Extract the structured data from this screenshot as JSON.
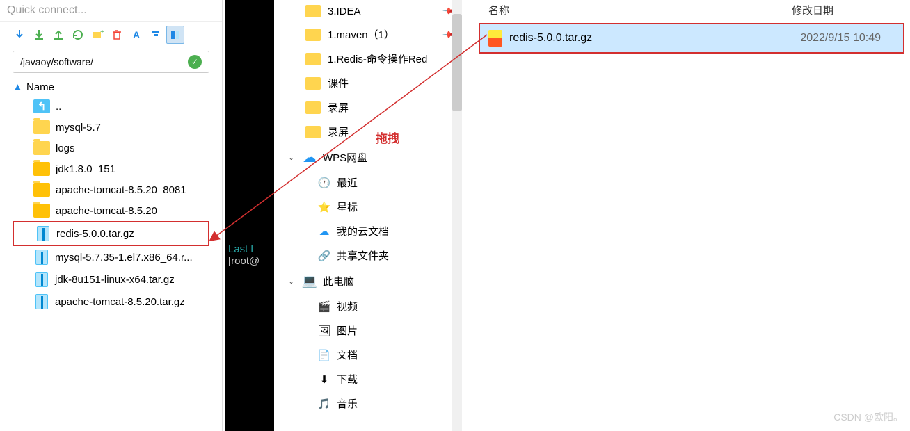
{
  "quickConnect": "Quick connect...",
  "path": "/javaoy/software/",
  "treeHeader": "Name",
  "files": [
    {
      "name": "..",
      "type": "up"
    },
    {
      "name": "mysql-5.7",
      "type": "folder"
    },
    {
      "name": "logs",
      "type": "folder"
    },
    {
      "name": "jdk1.8.0_151",
      "type": "folder-open"
    },
    {
      "name": "apache-tomcat-8.5.20_8081",
      "type": "folder-open"
    },
    {
      "name": "apache-tomcat-8.5.20",
      "type": "folder-open"
    },
    {
      "name": "redis-5.0.0.tar.gz",
      "type": "archive",
      "highlighted": true
    },
    {
      "name": "mysql-5.7.35-1.el7.x86_64.r...",
      "type": "archive"
    },
    {
      "name": "jdk-8u151-linux-x64.tar.gz",
      "type": "archive"
    },
    {
      "name": "apache-tomcat-8.5.20.tar.gz",
      "type": "archive"
    }
  ],
  "terminal": {
    "line1": "Last l",
    "line2": "[root@"
  },
  "quickAccess": [
    {
      "name": "3.IDEA",
      "pinned": true
    },
    {
      "name": "1.maven（1）",
      "pinned": true
    },
    {
      "name": "1.Redis-命令操作Red",
      "pinned": false
    },
    {
      "name": "课件",
      "pinned": false
    },
    {
      "name": "录屏",
      "pinned": false
    },
    {
      "name": "录屏",
      "pinned": false
    }
  ],
  "wpsSection": {
    "title": "WPS网盘",
    "items": [
      {
        "name": "最近",
        "icon": "clock",
        "color": "#2196F3"
      },
      {
        "name": "星标",
        "icon": "star",
        "color": "#FFC107"
      },
      {
        "name": "我的云文档",
        "icon": "cloud",
        "color": "#2196F3"
      },
      {
        "name": "共享文件夹",
        "icon": "share",
        "color": "#2196F3"
      }
    ]
  },
  "pcSection": {
    "title": "此电脑",
    "items": [
      {
        "name": "视频",
        "icon": "video"
      },
      {
        "name": "图片",
        "icon": "image"
      },
      {
        "name": "文档",
        "icon": "doc"
      },
      {
        "name": "下载",
        "icon": "download"
      },
      {
        "name": "音乐",
        "icon": "music"
      }
    ]
  },
  "rightHeader": {
    "name": "名称",
    "date": "修改日期"
  },
  "rightFile": {
    "name": "redis-5.0.0.tar.gz",
    "date": "2022/9/15 10:49"
  },
  "dragLabel": "拖拽",
  "watermark": "CSDN @欧阳。"
}
